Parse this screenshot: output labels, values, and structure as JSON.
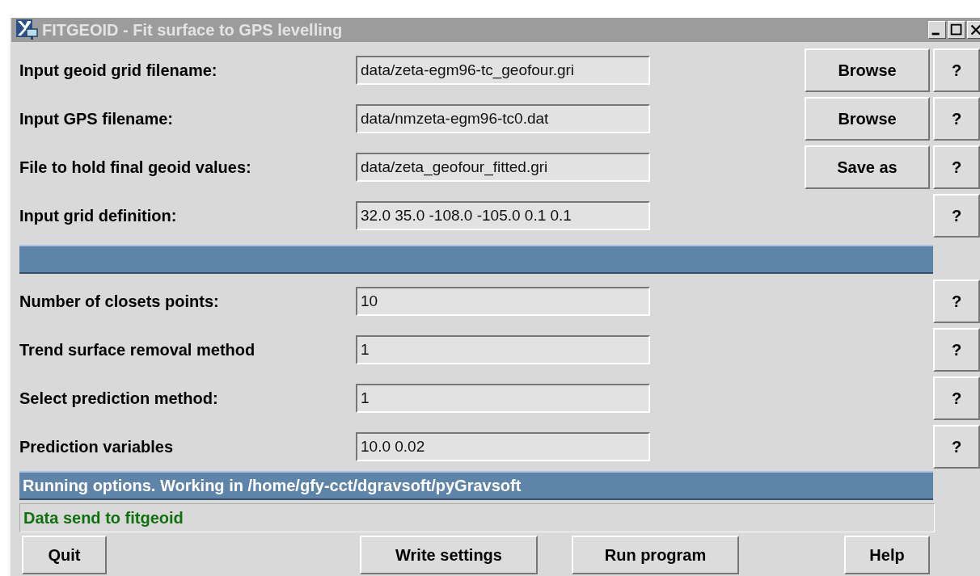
{
  "window": {
    "title": "FITGEOID - Fit surface to GPS levelling"
  },
  "input_rows": [
    {
      "label": "Input geoid grid filename:",
      "value": "data/zeta-egm96-tc_geofour.gri",
      "action": "Browse",
      "help": "?"
    },
    {
      "label": "Input GPS filename:",
      "value": "data/nmzeta-egm96-tc0.dat",
      "action": "Browse",
      "help": "?"
    },
    {
      "label": "File to hold final geoid values:",
      "value": "data/zeta_geofour_fitted.gri",
      "action": "Save as",
      "help": "?"
    },
    {
      "label": "Input grid definition:",
      "value": "32.0 35.0 -108.0 -105.0 0.1 0.1",
      "help": "?"
    }
  ],
  "option_rows": [
    {
      "label": "Number of closets points:",
      "value": "10",
      "help": "?"
    },
    {
      "label": "Trend surface removal method",
      "value": "1",
      "help": "?"
    },
    {
      "label": "Select prediction method:",
      "value": "1",
      "help": "?"
    },
    {
      "label": "Prediction variables",
      "value": "10.0 0.02",
      "help": "?"
    }
  ],
  "status_bar": {
    "heading": "Running options. Working in /home/gfy-cct/dgravsoft/pyGravsoft",
    "message": "Data send to fitgeoid"
  },
  "buttons": [
    {
      "label": "Quit"
    },
    {
      "label": "Write settings"
    },
    {
      "label": "Run program"
    },
    {
      "label": "Help"
    }
  ]
}
